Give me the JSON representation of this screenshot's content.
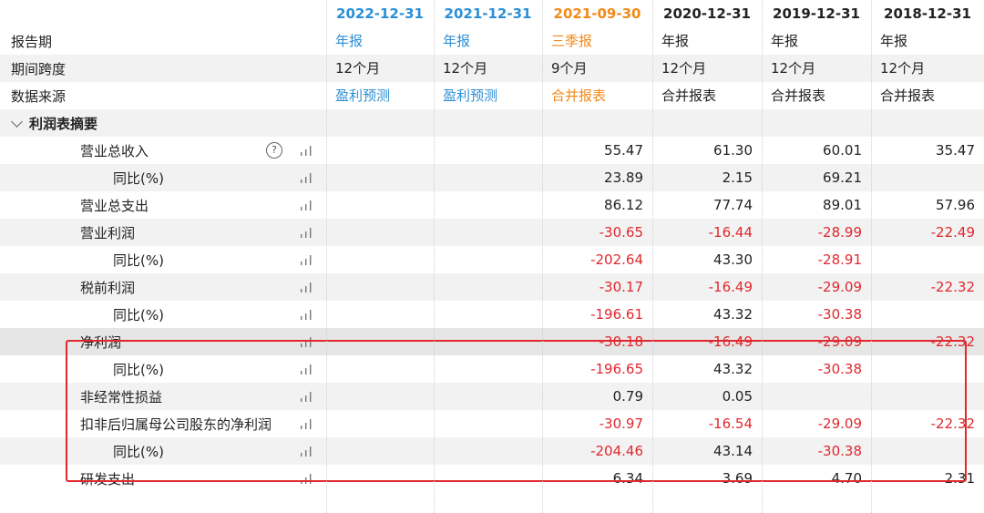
{
  "columns": [
    {
      "date": "2022-12-31",
      "type": "年报",
      "span": "12个月",
      "source": "盈利预测",
      "date_color": "#2b8fd6",
      "text_color": "#2b8fd6"
    },
    {
      "date": "2021-12-31",
      "type": "年报",
      "span": "12个月",
      "source": "盈利预测",
      "date_color": "#2b8fd6",
      "text_color": "#2b8fd6"
    },
    {
      "date": "2021-09-30",
      "type": "三季报",
      "span": "9个月",
      "source": "合并报表",
      "date_color": "#f08a19",
      "text_color": "#f08a19"
    },
    {
      "date": "2020-12-31",
      "type": "年报",
      "span": "12个月",
      "source": "合并报表",
      "date_color": "#222222",
      "text_color": "#222222"
    },
    {
      "date": "2019-12-31",
      "type": "年报",
      "span": "12个月",
      "source": "合并报表",
      "date_color": "#222222",
      "text_color": "#222222"
    },
    {
      "date": "2018-12-31",
      "type": "年报",
      "span": "12个月",
      "source": "合并报表",
      "date_color": "#222222",
      "text_color": "#222222"
    }
  ],
  "meta_labels": {
    "report_period": "报告期",
    "span": "期间跨度",
    "source": "数据来源"
  },
  "section_title": "利润表摘要",
  "help_glyph": "?",
  "rows": [
    {
      "label": "营业总收入",
      "indent": 1,
      "help": true,
      "values": [
        "",
        "",
        "55.47",
        "61.30",
        "60.01",
        "35.47"
      ]
    },
    {
      "label": "同比(%)",
      "indent": 2,
      "values": [
        "",
        "",
        "23.89",
        "2.15",
        "69.21",
        ""
      ]
    },
    {
      "label": "营业总支出",
      "indent": 1,
      "values": [
        "",
        "",
        "86.12",
        "77.74",
        "89.01",
        "57.96"
      ]
    },
    {
      "label": "营业利润",
      "indent": 1,
      "values": [
        "",
        "",
        "-30.65",
        "-16.44",
        "-28.99",
        "-22.49"
      ]
    },
    {
      "label": "同比(%)",
      "indent": 2,
      "values": [
        "",
        "",
        "-202.64",
        "43.30",
        "-28.91",
        ""
      ]
    },
    {
      "label": "税前利润",
      "indent": 1,
      "values": [
        "",
        "",
        "-30.17",
        "-16.49",
        "-29.09",
        "-22.32"
      ]
    },
    {
      "label": "同比(%)",
      "indent": 2,
      "values": [
        "",
        "",
        "-196.61",
        "43.32",
        "-30.38",
        ""
      ]
    },
    {
      "label": "净利润",
      "indent": 1,
      "highlight": true,
      "values": [
        "",
        "",
        "-30.18",
        "-16.49",
        "-29.09",
        "-22.32"
      ]
    },
    {
      "label": "同比(%)",
      "indent": 2,
      "values": [
        "",
        "",
        "-196.65",
        "43.32",
        "-30.38",
        ""
      ]
    },
    {
      "label": "非经常性损益",
      "indent": 1,
      "values": [
        "",
        "",
        "0.79",
        "0.05",
        "",
        ""
      ]
    },
    {
      "label": "扣非后归属母公司股东的净利润",
      "indent": 1,
      "values": [
        "",
        "",
        "-30.97",
        "-16.54",
        "-29.09",
        "-22.32"
      ]
    },
    {
      "label": "同比(%)",
      "indent": 2,
      "values": [
        "",
        "",
        "-204.46",
        "43.14",
        "-30.38",
        ""
      ]
    },
    {
      "label": "研发支出",
      "indent": 1,
      "values": [
        "",
        "",
        "6.34",
        "3.69",
        "4.70",
        "2.31"
      ]
    }
  ],
  "colors": {
    "negative": "#e0282e",
    "highlight_box": "#e0282e",
    "shade": "#f2f2f2"
  }
}
